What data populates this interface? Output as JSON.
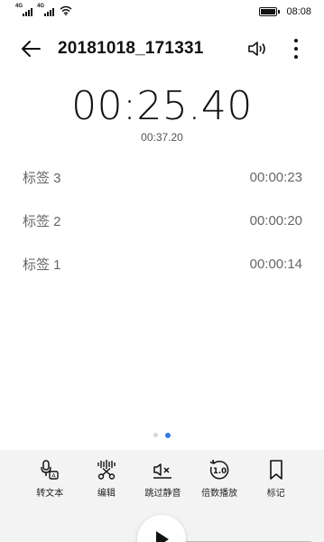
{
  "status_bar": {
    "signal1_label": "4G",
    "signal2_label": "4G",
    "time": "08:08"
  },
  "toolbar": {
    "title": "20181018_171331"
  },
  "playback": {
    "elapsed": "00:25.40",
    "total": "00:37.20"
  },
  "marks": [
    {
      "label": "标签 3",
      "time": "00:00:23"
    },
    {
      "label": "标签 2",
      "time": "00:00:20"
    },
    {
      "label": "标签 1",
      "time": "00:00:14"
    }
  ],
  "pager": {
    "pages": 2,
    "active": 2
  },
  "actions": [
    {
      "label": "转文本",
      "icon": "speech-to-text-icon"
    },
    {
      "label": "编辑",
      "icon": "scissors-waveform-icon"
    },
    {
      "label": "跳过静音",
      "icon": "skip-silence-icon"
    },
    {
      "label": "倍数播放",
      "icon": "playback-speed-icon",
      "value": "1.0"
    },
    {
      "label": "标记",
      "icon": "bookmark-icon"
    }
  ],
  "colors": {
    "accent": "#2d7ee6",
    "panel_bg": "#f3f3f3"
  }
}
